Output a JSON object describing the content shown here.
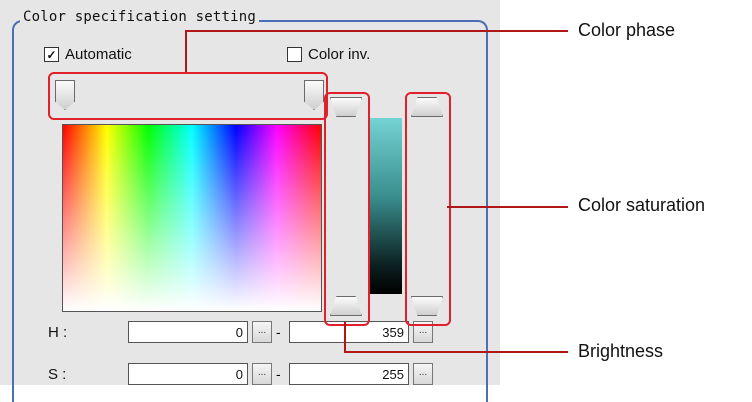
{
  "group": {
    "title": "Color specification setting"
  },
  "options": {
    "automatic_label": "Automatic",
    "automatic_checked": true,
    "color_inv_label": "Color inv.",
    "color_inv_checked": false
  },
  "fields": {
    "h": {
      "label": "H :",
      "min": "0",
      "sep": "-",
      "max": "359",
      "btn": "..."
    },
    "s": {
      "label": "S :",
      "min": "0",
      "sep": "-",
      "max": "255",
      "btn": "..."
    }
  },
  "callouts": {
    "color_phase": "Color phase",
    "color_saturation": "Color saturation",
    "brightness": "Brightness"
  },
  "colors": {
    "callout_border": "#e0202a",
    "group_border": "#4a6fb5",
    "panel_bg": "#e6e6e6"
  }
}
